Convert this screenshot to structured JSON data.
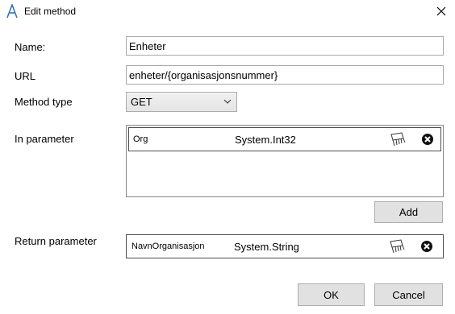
{
  "window": {
    "title": "Edit method"
  },
  "fields": {
    "name": {
      "label": "Name:",
      "value": "Enheter"
    },
    "url": {
      "label": "URL",
      "value": "enheter/{organisasjonsnummer}"
    },
    "method_type": {
      "label": "Method type",
      "selected": "GET"
    }
  },
  "in_parameter": {
    "label": "In parameter",
    "rows": [
      {
        "name": "Org",
        "type": "System.Int32"
      }
    ],
    "add_label": "Add"
  },
  "return_parameter": {
    "label": "Return parameter",
    "row": {
      "name": "NavnOrganisasjon",
      "type": "System.String"
    }
  },
  "buttons": {
    "ok": "OK",
    "cancel": "Cancel"
  },
  "icons": {
    "app": "app-logo-icon",
    "close": "close-icon",
    "edit": "edit-hand-icon",
    "delete": "delete-circle-icon",
    "dropdown": "chevron-down-icon"
  }
}
